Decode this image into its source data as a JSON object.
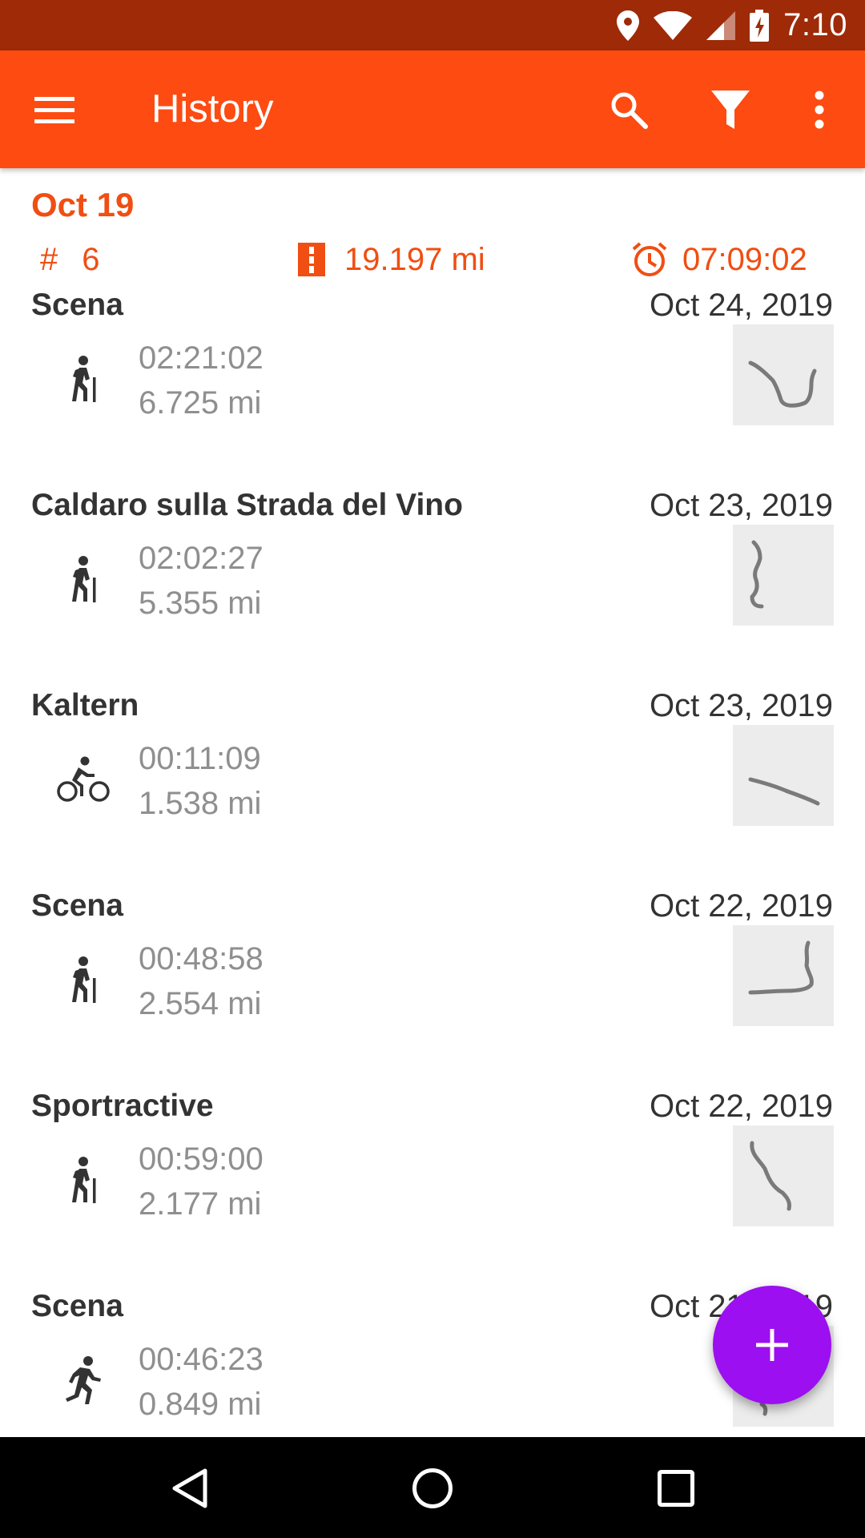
{
  "status_bar": {
    "time": "7:10"
  },
  "toolbar": {
    "title": "History"
  },
  "summary": {
    "date": "Oct 19",
    "count_symbol": "#",
    "count": "6",
    "distance": "19.197 mi",
    "duration": "07:09:02"
  },
  "activities": [
    {
      "name": "Scena",
      "date": "Oct 24, 2019",
      "type_icon": "hiking-icon",
      "duration": "02:21:02",
      "distance": "6.725 mi"
    },
    {
      "name": "Caldaro sulla Strada del Vino",
      "date": "Oct 23, 2019",
      "type_icon": "hiking-icon",
      "duration": "02:02:27",
      "distance": "5.355 mi"
    },
    {
      "name": "Kaltern",
      "date": "Oct 23, 2019",
      "type_icon": "cycling-icon",
      "duration": "00:11:09",
      "distance": "1.538 mi"
    },
    {
      "name": "Scena",
      "date": "Oct 22, 2019",
      "type_icon": "hiking-icon",
      "duration": "00:48:58",
      "distance": "2.554 mi"
    },
    {
      "name": "Sportractive",
      "date": "Oct 22, 2019",
      "type_icon": "hiking-icon",
      "duration": "00:59:00",
      "distance": "2.177 mi"
    },
    {
      "name": "Scena",
      "date": "Oct 21, 2019",
      "type_icon": "running-icon",
      "duration": "00:46:23",
      "distance": "0.849 mi"
    }
  ],
  "colors": {
    "status_bar": "#9e2a08",
    "toolbar": "#fe4b12",
    "accent": "#f04e12",
    "fab": "#9b0ff0"
  }
}
